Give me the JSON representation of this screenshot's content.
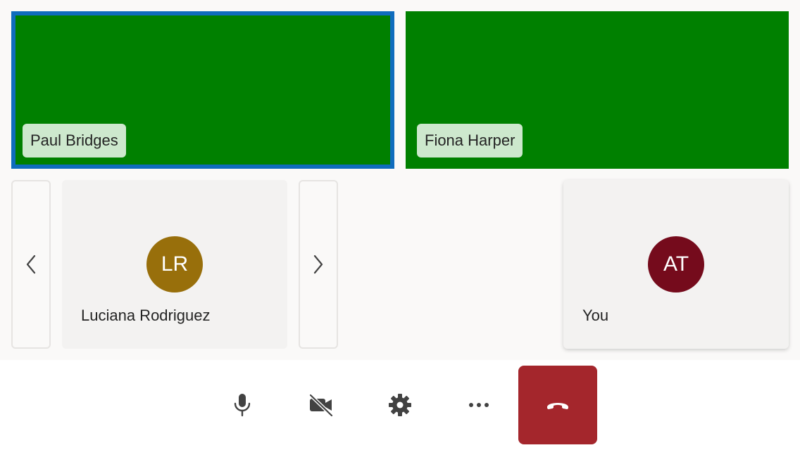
{
  "stage": {
    "featured": [
      {
        "name": "Paul Bridges",
        "active": true
      },
      {
        "name": "Fiona Harper",
        "active": false
      }
    ],
    "gallery": {
      "prev_icon": "chevron-left-icon",
      "next_icon": "chevron-right-icon",
      "participant": {
        "initials": "LR",
        "name": "Luciana Rodriguez",
        "avatar_color": "#986f0b"
      }
    },
    "self": {
      "initials": "AT",
      "name": "You",
      "avatar_color": "#750b1c"
    }
  },
  "colors": {
    "video_bg": "#008000",
    "active_border": "#0f6cbd",
    "name_tag_bg": "#cde8cd",
    "hangup_bg": "#a4262c",
    "icon": "#424242"
  },
  "toolbar": {
    "buttons": [
      {
        "icon": "microphone-icon"
      },
      {
        "icon": "camera-off-icon"
      },
      {
        "icon": "settings-icon"
      },
      {
        "icon": "more-options-icon"
      },
      {
        "icon": "hang-up-icon"
      }
    ]
  }
}
